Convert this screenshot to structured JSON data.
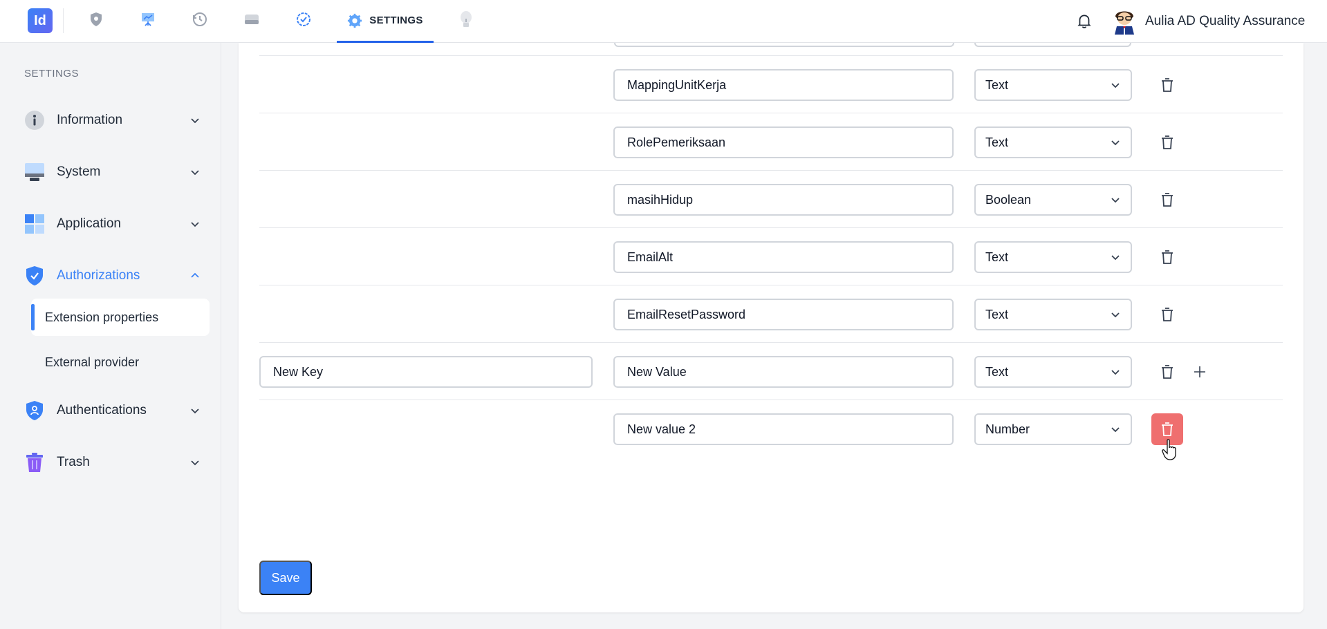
{
  "header": {
    "logo_text": "Id",
    "active_tab_label": "SETTINGS",
    "user_name": "Aulia AD Quality Assurance"
  },
  "sidebar": {
    "heading": "SETTINGS",
    "items": [
      {
        "label": "Information",
        "icon": "info-icon"
      },
      {
        "label": "System",
        "icon": "monitor-icon"
      },
      {
        "label": "Application",
        "icon": "grid-icon"
      },
      {
        "label": "Authorizations",
        "icon": "shield-check-icon"
      },
      {
        "label": "Authentications",
        "icon": "shield-user-icon"
      },
      {
        "label": "Trash",
        "icon": "trash-icon"
      }
    ],
    "sub_items": [
      {
        "label": "Extension properties"
      },
      {
        "label": "External provider"
      }
    ]
  },
  "properties": {
    "rows": [
      {
        "key": "",
        "value": "MappingUnitKerja",
        "type": "Text"
      },
      {
        "key": "",
        "value": "RolePemeriksaan",
        "type": "Text"
      },
      {
        "key": "",
        "value": "masihHidup",
        "type": "Boolean"
      },
      {
        "key": "",
        "value": "EmailAlt",
        "type": "Text"
      },
      {
        "key": "",
        "value": "EmailResetPassword",
        "type": "Text"
      },
      {
        "key": "New Key",
        "value": "New Value",
        "type": "Text"
      },
      {
        "key": "",
        "value": "New value 2",
        "type": "Number"
      }
    ],
    "save_label": "Save"
  },
  "colors": {
    "accent": "#3b82f6",
    "danger": "#ef6f6f"
  }
}
